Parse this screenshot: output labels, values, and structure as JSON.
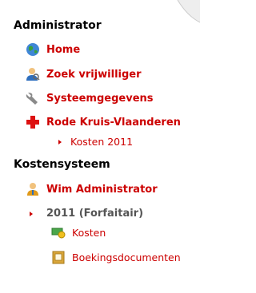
{
  "sections": {
    "admin": {
      "title": "Administrator",
      "items": [
        {
          "label": "Home",
          "icon": "globe-icon"
        },
        {
          "label": "Zoek vrijwilliger",
          "icon": "user-search-icon"
        },
        {
          "label": "Systeemgegevens",
          "icon": "wrench-icon"
        },
        {
          "label": "Rode Kruis-Vlaanderen",
          "icon": "red-cross-icon"
        }
      ],
      "subitem": {
        "label": "Kosten 2011"
      }
    },
    "kosten": {
      "title": "Kostensysteem",
      "user": {
        "label": "Wim Administrator",
        "icon": "user-icon"
      },
      "year": {
        "label": "2011 (Forfaitair)"
      },
      "subitems": [
        {
          "label": "Kosten",
          "icon": "money-icon"
        },
        {
          "label": "Boekingsdocumenten",
          "icon": "document-folder-icon"
        }
      ]
    }
  },
  "colors": {
    "link": "#cc0000",
    "muted": "#555555"
  }
}
